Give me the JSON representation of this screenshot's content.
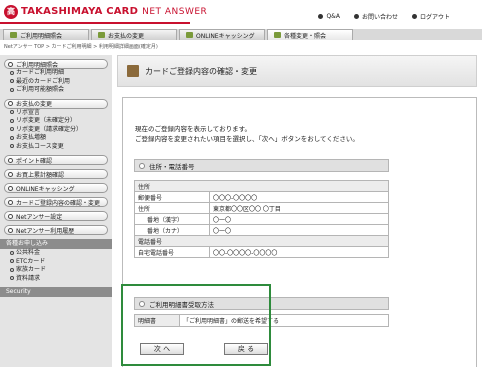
{
  "header": {
    "logo_mark": "高",
    "brand": "TAKASHIMAYA CARD",
    "brand_sub": "NET ANSWER",
    "links": [
      "Q&A",
      "お問い合わせ",
      "ログアウト"
    ]
  },
  "tabs": [
    "ご利用明細照会",
    "お支払の変更",
    "ONLINEキャッシング",
    "各種変更・照会"
  ],
  "breadcrumb": "Netアンサー TOP > カードご利用明細 > 利用明細詳細画面(確定月)",
  "sidebar": {
    "sec1": "ご利用明細照会",
    "sec1_items": [
      "カードご利用明細",
      "最近のカードご利用",
      "ご利用可能額照会"
    ],
    "sec2": "お支払の変更",
    "sec2_items": [
      "リボ宣言",
      "リボ変更（未確定分）",
      "リボ変更（請求確定分）",
      "お支払増額",
      "お支払コース変更"
    ],
    "sec3": "ポイント確認",
    "sec4": "お買上累計額確認",
    "sec5": "ONLINEキャッシング",
    "sec6": "カードご登録内容の確認・変更",
    "sec7": "Netアンサー設定",
    "sec8": "Netアンサー利用履歴",
    "grey1": "各種お申し込み",
    "grey1_items": [
      "公共料金",
      "ETCカード",
      "家族カード",
      "資料請求"
    ],
    "grey2": "Security"
  },
  "main": {
    "title": "カードご登録内容の確認・変更",
    "intro_line1": "現在のご登録内容を表示しております。",
    "intro_line2": "ご登録内容を変更されたい項目を選択し、「次へ」ボタンをおしてください。",
    "section1_title": "住所・電話番号",
    "address_header": "住所",
    "postal_label": "郵便番号",
    "postal_value": "〇〇〇-〇〇〇〇",
    "address_label": "住所",
    "address_value": "東京都〇〇区〇〇 〇丁目",
    "banchi_kanji_label": "番地（漢字）",
    "banchi_kanji_value": "〇一〇",
    "banchi_kana_label": "番地（カナ）",
    "banchi_kana_value": "〇一〇",
    "phone_header": "電話番号",
    "home_phone_label": "自宅電話番号",
    "home_phone_value": "〇〇-〇〇〇〇-〇〇〇〇",
    "section2_title": "ご利用明細書受取方法",
    "stmt_label": "明細書",
    "stmt_value": "「ご利用明細書」の郵送を希望する",
    "next_button": "次 へ",
    "back_button": "戻 る"
  },
  "colors": {
    "brand_red": "#c8102e",
    "highlight_green": "#2e8b3c"
  }
}
